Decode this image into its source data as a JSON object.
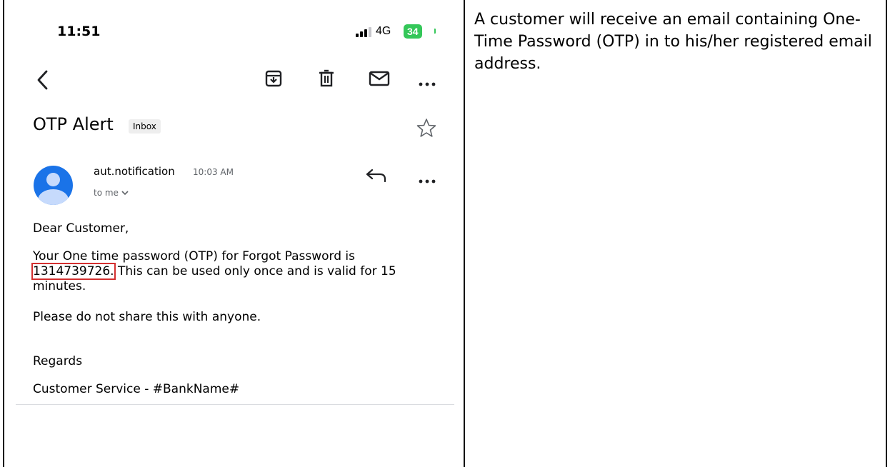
{
  "description": "A customer will receive an email containing One-Time Password (OTP) in to his/her registered email address.",
  "status_bar": {
    "time": "11:51",
    "network": "4G",
    "battery": "34"
  },
  "toolbar": {
    "icons": [
      "back-icon",
      "archive-icon",
      "trash-icon",
      "mail-icon",
      "more-icon"
    ]
  },
  "email": {
    "subject": "OTP Alert",
    "label": "Inbox",
    "sender": "aut.notification",
    "time": "10:03 AM",
    "recipient": "to me",
    "greeting": "Dear Customer,",
    "otp_intro": "Your One time password (OTP) for Forgot Password is",
    "otp_code": "1314739726.",
    "otp_rest": " This can be used only once and is valid for 15 minutes.",
    "share_warning": "Please do not share this with anyone.",
    "regards": "Regards",
    "signature": "Customer Service - #BankName#"
  },
  "colors": {
    "battery": "#34c759",
    "avatar": "#1a73e8",
    "highlight": "#d32f2f"
  }
}
